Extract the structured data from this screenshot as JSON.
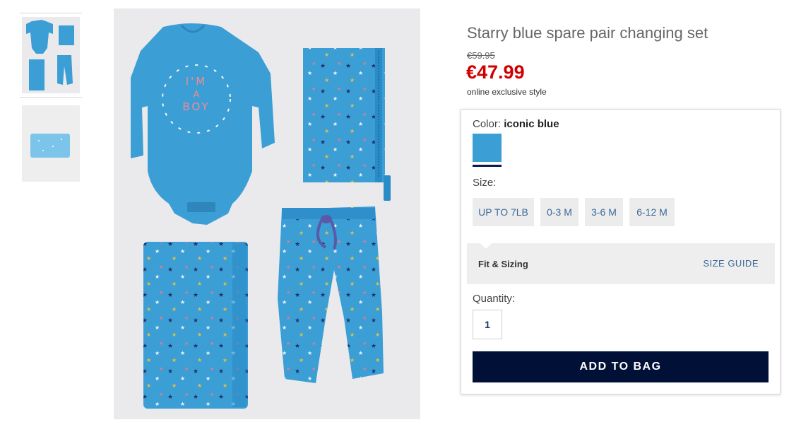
{
  "product": {
    "title": "Starry blue spare pair changing set",
    "original_price": "€59.95",
    "sale_price": "€47.99",
    "promo_text": "online exclusive style",
    "bodysuit_print": "I'M A BOY"
  },
  "options": {
    "color_label": "Color:",
    "color_value": "iconic blue",
    "swatch_color": "#3b9fd6",
    "size_label": "Size:",
    "sizes": [
      "UP TO 7LB",
      "0-3 M",
      "3-6 M",
      "6-12 M"
    ],
    "fit_label": "Fit & Sizing",
    "size_guide": "SIZE GUIDE",
    "quantity_label": "Quantity:",
    "quantity_value": "1",
    "add_to_bag": "ADD TO BAG"
  },
  "colors": {
    "sale_price": "#d00000",
    "button_bg": "#001036",
    "link": "#3a6a9a",
    "garment": "#3b9fd6"
  }
}
